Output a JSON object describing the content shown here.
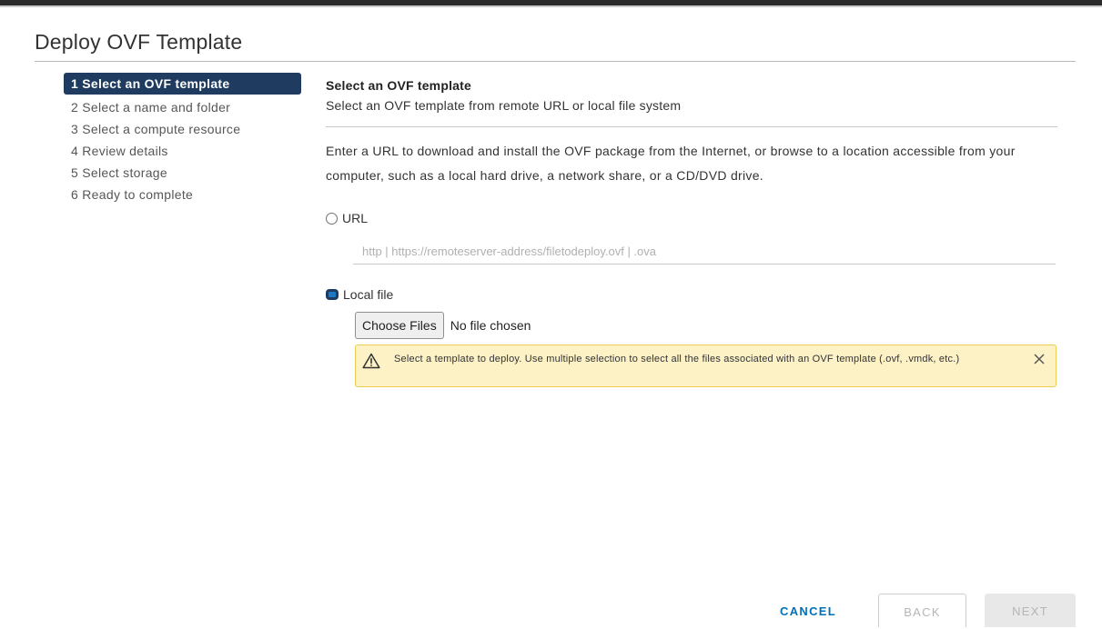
{
  "dialog": {
    "title": "Deploy OVF Template"
  },
  "steps": [
    {
      "label": "1 Select an OVF template",
      "active": true
    },
    {
      "label": "2 Select a name and folder",
      "active": false
    },
    {
      "label": "3 Select a compute resource",
      "active": false
    },
    {
      "label": "4 Review details",
      "active": false
    },
    {
      "label": "5 Select storage",
      "active": false
    },
    {
      "label": "6 Ready to complete",
      "active": false
    }
  ],
  "content": {
    "heading": "Select an OVF template",
    "subheading": "Select an OVF template from remote URL or local file system",
    "description": "Enter a URL to download and install the OVF package from the Internet, or browse to a location accessible from your computer, such as a local hard drive, a network share, or a CD/DVD drive.",
    "url_option": {
      "label": "URL",
      "selected": false
    },
    "url_input": {
      "value": "",
      "placeholder": "http | https://remoteserver-address/filetodeploy.ovf | .ova"
    },
    "local_option": {
      "label": "Local file",
      "selected": true
    },
    "file_picker": {
      "button_label": "Choose Files",
      "status": "No file chosen"
    },
    "alert": {
      "type": "warning",
      "icon": "warning-triangle-icon",
      "text": "Select a template to deploy. Use multiple selection to select all the files associated with an OVF template (.ovf, .vmdk, etc.)",
      "close_icon": "close-icon"
    }
  },
  "footer": {
    "cancel_label": "CANCEL",
    "back_label": "BACK",
    "next_label": "NEXT"
  },
  "colors": {
    "active_step": "#1f3b60",
    "link_blue": "#0071b9",
    "alert_bg": "#fdf1c6",
    "alert_border": "#eecb51"
  }
}
